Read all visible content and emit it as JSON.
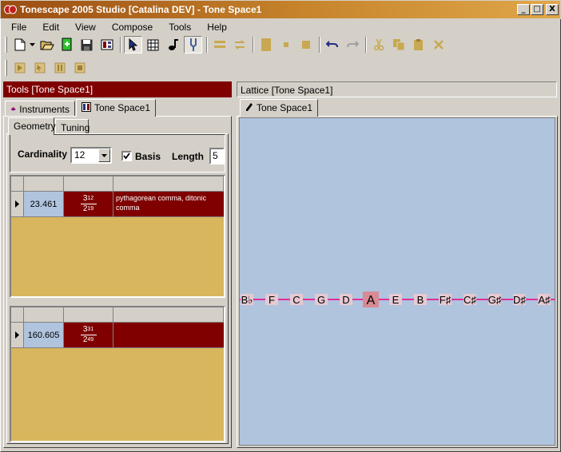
{
  "window": {
    "title": "Tonescape 2005 Studio [Catalina DEV]  -  Tone Space1",
    "controls": {
      "minimize": "_",
      "maximize": "□",
      "close": "X"
    }
  },
  "menu": [
    "File",
    "Edit",
    "View",
    "Compose",
    "Tools",
    "Help"
  ],
  "toolbar1": [
    {
      "icon": "new-file-icon"
    },
    {
      "icon": "dropdown-arrow-icon"
    },
    {
      "icon": "open-folder-icon"
    },
    {
      "icon": "import-icon"
    },
    {
      "icon": "save-icon"
    },
    {
      "icon": "properties-icon"
    },
    {
      "icon": "select-pointer-icon"
    },
    {
      "icon": "grid-icon"
    },
    {
      "icon": "note-icon"
    },
    {
      "icon": "tuning-fork-icon"
    },
    {
      "icon": "align-icon"
    },
    {
      "icon": "loop-icon"
    },
    {
      "icon": "block-icon"
    },
    {
      "icon": "small-square-icon"
    },
    {
      "icon": "square-dot-icon"
    },
    {
      "icon": "undo-icon"
    },
    {
      "icon": "redo-icon"
    },
    {
      "icon": "cut-icon"
    },
    {
      "icon": "copy-icon"
    },
    {
      "icon": "paste-icon"
    },
    {
      "icon": "delete-icon"
    }
  ],
  "toolbar2": [
    {
      "icon": "play-icon"
    },
    {
      "icon": "step-icon"
    },
    {
      "icon": "pause-icon"
    },
    {
      "icon": "stop-icon"
    }
  ],
  "tools_panel": {
    "header": "Tools  [Tone Space1]",
    "tabs": [
      "Instruments",
      "Tone Space1"
    ],
    "subtabs": [
      "Geometry",
      "Tuning"
    ],
    "geometry": {
      "cardinality_label": "Cardinality",
      "cardinality_value": "12",
      "basis_label": "Basis",
      "basis_checked": true,
      "length_label": "Length",
      "length_value": "5"
    },
    "grid1": {
      "rows": [
        {
          "value": "23.461",
          "num_base": "3",
          "num_exp": "12",
          "den_base": "2",
          "den_exp": "19",
          "name": "pythagorean comma, ditonic comma"
        }
      ]
    },
    "grid2": {
      "rows": [
        {
          "value": "160.605",
          "num_base": "3",
          "num_exp": "31",
          "den_base": "2",
          "den_exp": "49",
          "name": ""
        }
      ]
    }
  },
  "lattice_panel": {
    "header": "Lattice  [Tone Space1]",
    "tab": "Tone Space1",
    "notes": [
      {
        "label": "B♭",
        "highlight": false
      },
      {
        "label": "F",
        "highlight": false
      },
      {
        "label": "C",
        "highlight": false
      },
      {
        "label": "G",
        "highlight": false
      },
      {
        "label": "D",
        "highlight": false
      },
      {
        "label": "A",
        "highlight": true
      },
      {
        "label": "E",
        "highlight": false
      },
      {
        "label": "B",
        "highlight": false
      },
      {
        "label": "F♯",
        "highlight": false
      },
      {
        "label": "C♯",
        "highlight": false
      },
      {
        "label": "G♯",
        "highlight": false
      },
      {
        "label": "D♯",
        "highlight": false
      },
      {
        "label": "A♯",
        "highlight": false
      }
    ],
    "colors": {
      "line": "#e0309a",
      "node": "#e7c9d2",
      "highlight": "#d88a95",
      "background": "#b0c4de"
    }
  }
}
